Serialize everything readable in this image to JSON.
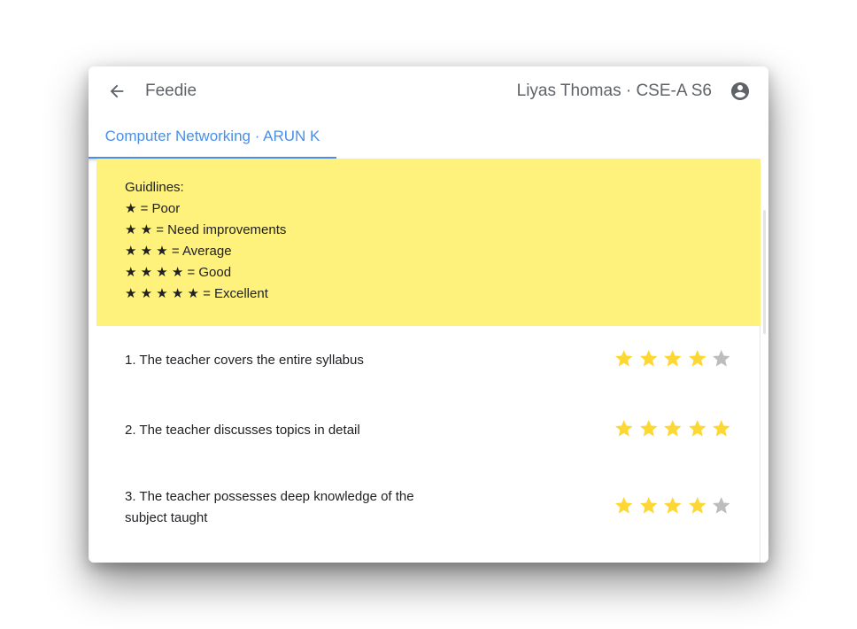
{
  "app": {
    "title": "Feedie",
    "user_label": "Liyas Thomas · CSE-A S6"
  },
  "tabs": [
    {
      "label": "Computer Networking · ARUN K"
    }
  ],
  "guidelines": {
    "title": "Guidlines:",
    "lines": [
      "★ = Poor",
      "★ ★ = Need improvements",
      "★ ★ ★ = Average",
      "★ ★ ★ ★ = Good",
      "★ ★ ★ ★ ★ = Excellent"
    ]
  },
  "questions": [
    {
      "text": "1. The teacher covers the entire syllabus",
      "rating": 4,
      "max": 5
    },
    {
      "text": "2. The teacher discusses topics in detail",
      "rating": 5,
      "max": 5
    },
    {
      "text": "3. The teacher possesses deep knowledge of the subject taught",
      "rating": 4,
      "max": 5
    }
  ],
  "colors": {
    "accent": "#4a8fe7",
    "star_filled": "#fdd835",
    "star_empty": "#bdbdbd",
    "guidelines_bg": "#fef17c"
  },
  "icons": {
    "back": "arrow-left-icon",
    "account": "account-circle-icon",
    "star": "star-icon"
  }
}
